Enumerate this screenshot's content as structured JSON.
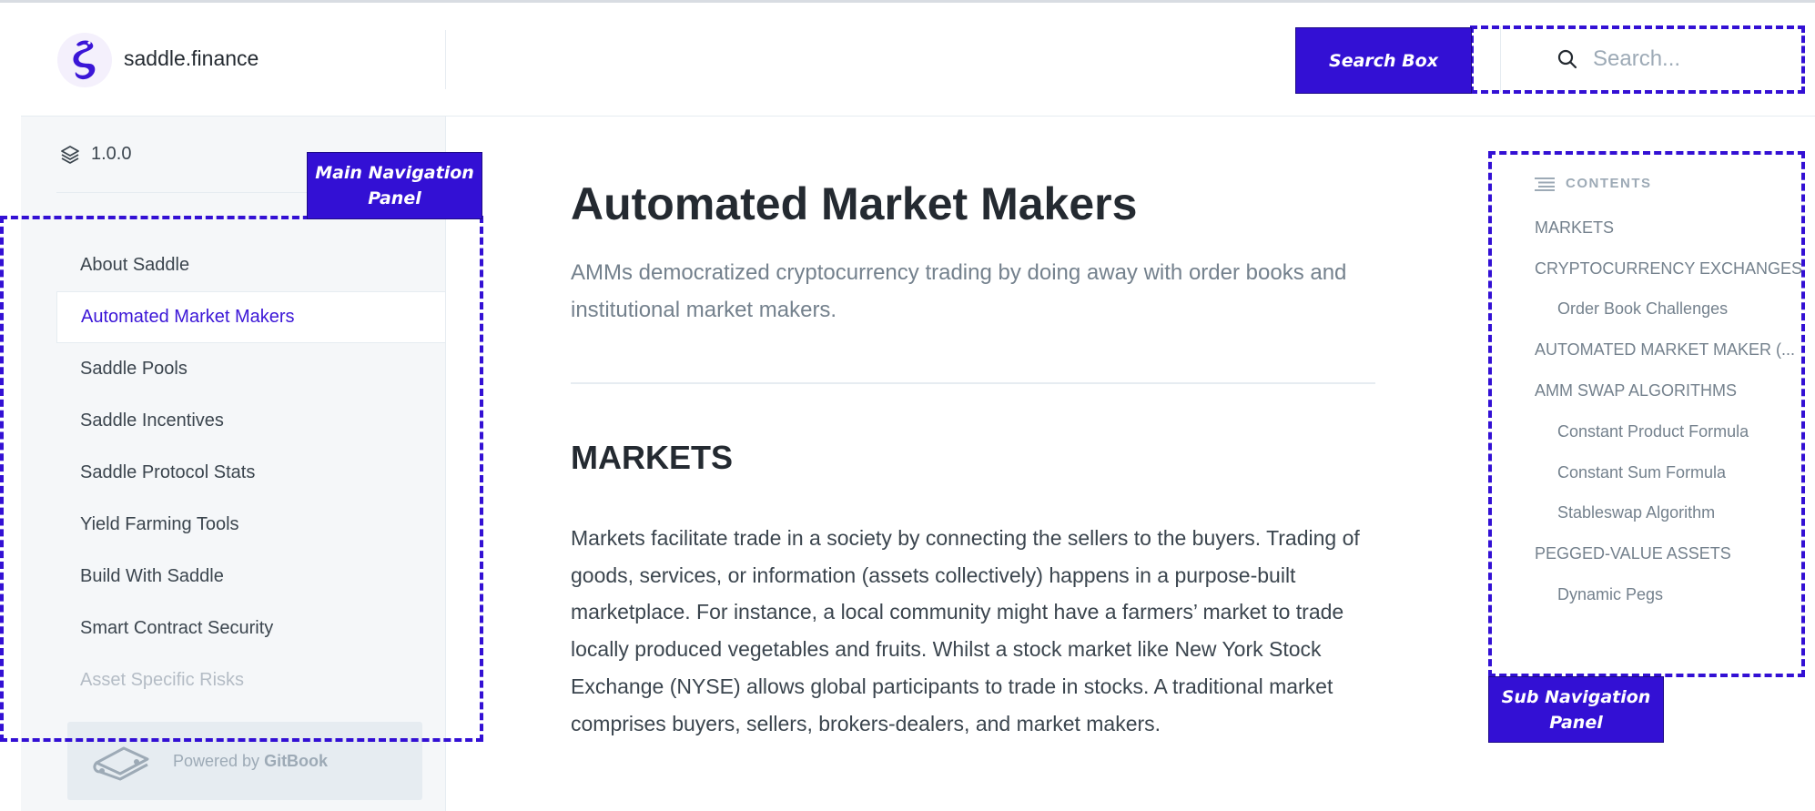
{
  "header": {
    "brand": "saddle.finance",
    "search": {
      "placeholder": "Search..."
    }
  },
  "sidebar": {
    "version": "1.0.0",
    "items": [
      {
        "label": "About Saddle"
      },
      {
        "label": "Automated Market Makers",
        "active": true
      },
      {
        "label": "Saddle Pools"
      },
      {
        "label": "Saddle Incentives"
      },
      {
        "label": "Saddle Protocol Stats"
      },
      {
        "label": "Yield Farming Tools"
      },
      {
        "label": "Build With Saddle"
      },
      {
        "label": "Smart Contract Security"
      },
      {
        "label": "Asset Specific Risks"
      }
    ],
    "powered_prefix": "Powered by ",
    "powered_brand": "GitBook"
  },
  "main": {
    "title": "Automated Market Makers",
    "description": "AMMs democratized cryptocurrency trading by doing away with order books and institutional market makers.",
    "section_heading": "MARKETS",
    "paragraph": "Markets facilitate trade in a society by connecting the sellers to the buyers. Trading of goods, services, or information (assets collectively) happens in a purpose-built marketplace. For instance, a local community might have a farmers’ market to trade locally produced vegetables and fruits. Whilst a stock market like New York Stock Exchange (NYSE) allows global participants to trade in stocks. A traditional market comprises buyers, sellers, brokers-dealers, and market makers."
  },
  "contents": {
    "heading": "CONTENTS",
    "items": [
      {
        "label": "MARKETS",
        "sub": false
      },
      {
        "label": "CRYPTOCURRENCY EXCHANGES",
        "sub": false
      },
      {
        "label": "Order Book Challenges",
        "sub": true
      },
      {
        "label": "AUTOMATED MARKET MAKER (...",
        "sub": false
      },
      {
        "label": "AMM SWAP ALGORITHMS",
        "sub": false
      },
      {
        "label": "Constant Product Formula",
        "sub": true
      },
      {
        "label": "Constant Sum Formula",
        "sub": true
      },
      {
        "label": "Stableswap Algorithm",
        "sub": true
      },
      {
        "label": "PEGGED-VALUE ASSETS",
        "sub": false
      },
      {
        "label": "Dynamic Pegs",
        "sub": true
      }
    ]
  },
  "annotations": {
    "search_box": "Search Box",
    "main_nav": "Main Navigation Panel",
    "sub_nav": "Sub Navigation Panel"
  },
  "colors": {
    "accent": "#3b16d7",
    "annotation": "#3310d4"
  }
}
